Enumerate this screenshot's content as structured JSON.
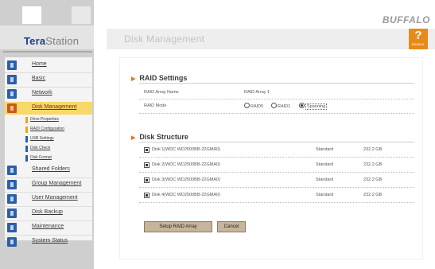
{
  "logo": {
    "part1": "Tera",
    "part2": "Station"
  },
  "brand": "BUFFALO",
  "page_title": "Disk Management",
  "help": {
    "symbol": "?",
    "label": "MANUAL"
  },
  "nav": [
    {
      "label": "Home",
      "icon": "home-icon"
    },
    {
      "label": "Basic",
      "icon": "basic-icon"
    },
    {
      "label": "Network",
      "icon": "network-icon"
    },
    {
      "label": "Disk Management",
      "icon": "disk-icon",
      "active": true
    },
    {
      "label": "Shared Folders",
      "icon": "folder-icon"
    },
    {
      "label": "Group Management",
      "icon": "group-icon"
    },
    {
      "label": "User Management",
      "icon": "user-icon"
    },
    {
      "label": "Disk Backup",
      "icon": "backup-icon"
    },
    {
      "label": "Maintenance",
      "icon": "maintenance-icon"
    },
    {
      "label": "System Status",
      "icon": "status-icon"
    }
  ],
  "subnav": [
    "Drive Properties",
    "RAID Configuration",
    "USB Settings",
    "Disk Check",
    "Disk Format"
  ],
  "raid": {
    "title": "RAID Settings",
    "name_label": "RAID Array Name",
    "name_value": "RAID Array 1",
    "mode_label": "RAID Mode",
    "modes": [
      "RAID5",
      "RAID1",
      "Spanning"
    ],
    "selected_mode": "Spanning"
  },
  "disks": {
    "title": "Disk Structure",
    "rows": [
      {
        "name": "Disk 1(WDC WD2500BB-22GMA0)",
        "type": "Standard",
        "size": "232.2 GB"
      },
      {
        "name": "Disk 2(WDC WD2500BB-22GMA0)",
        "type": "Standard",
        "size": "232.2 GB"
      },
      {
        "name": "Disk 3(WDC WD2500BB-22GMA0)",
        "type": "Standard",
        "size": "232.2 GB"
      },
      {
        "name": "Disk 4(WDC WD2500BB-22GMA0)",
        "type": "Standard",
        "size": "232.2 GB"
      }
    ]
  },
  "buttons": {
    "setup": "Setup RAID Array",
    "cancel": "Cancel"
  },
  "colors": {
    "accent": "#e88a1a",
    "nav_active": "#f7d86a",
    "button": "#c7b59b",
    "logo_blue": "#1a3f86"
  }
}
